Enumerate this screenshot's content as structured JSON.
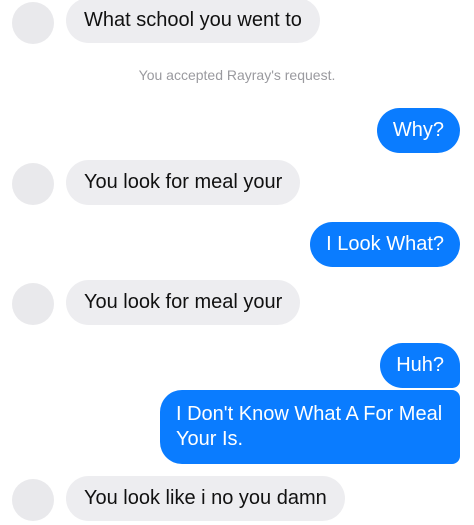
{
  "thread": {
    "notice": "You accepted Rayray's request.",
    "messages": [
      {
        "from": "them",
        "text": "What school you went to"
      },
      {
        "from": "me",
        "text": "Why?"
      },
      {
        "from": "them",
        "text": "You look for meal your"
      },
      {
        "from": "me",
        "text": "I Look What?"
      },
      {
        "from": "them",
        "text": "You look for meal your"
      },
      {
        "from": "me",
        "text": "Huh?"
      },
      {
        "from": "me",
        "text": "I Don't Know What A For Meal Your Is."
      },
      {
        "from": "them",
        "text": "You look like i no you damn"
      }
    ]
  },
  "colors": {
    "incoming_bubble": "#ededf0",
    "outgoing_bubble": "#0a7cff",
    "avatar_placeholder": "#e9e9ec"
  }
}
